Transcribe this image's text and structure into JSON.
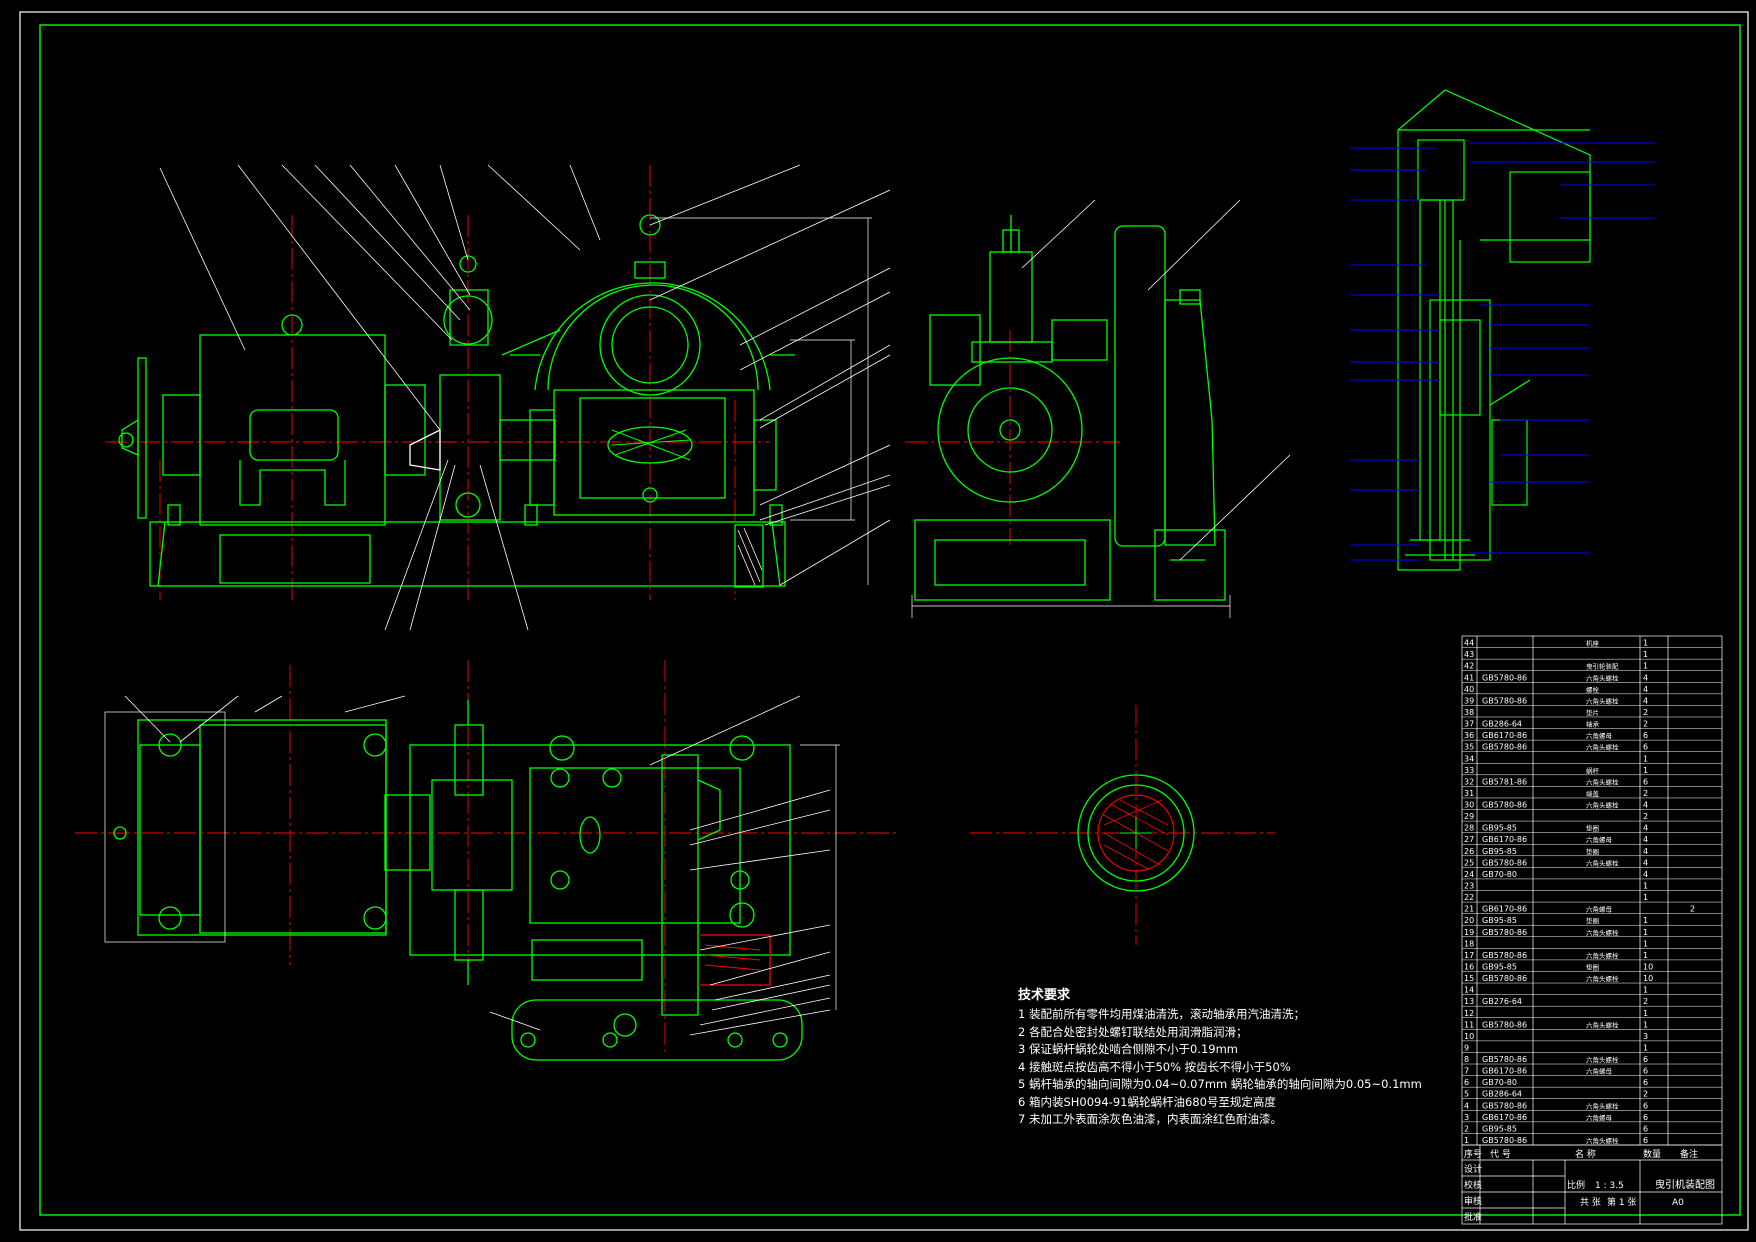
{
  "technical_requirements": {
    "title": "技术要求",
    "items": [
      "1 装配前所有零件均用煤油清洗，滚动轴承用汽油清洗；",
      "2 各配合处密封处螺钉联结处用润滑脂润滑；",
      "3 保证蜗杆蜗轮处啮合侧隙不小于0.19mm",
      "4 接触斑点按齿高不得小于50%  按齿长不得小于50%",
      "5 蜗杆轴承的轴向间隙为0.04~0.07mm 蜗轮轴承的轴向间隙为0.05~0.1mm",
      "6 箱内装SH0094-91蜗轮蜗杆油680号至规定高度",
      "7 未加工外表面涂灰色油漆，内表面涂红色耐油漆。"
    ]
  },
  "parts_list": {
    "headers": [
      "序号",
      "代 号",
      "名 称",
      "数量",
      "备注"
    ],
    "rows": [
      {
        "no": "44",
        "code": "",
        "name": "机座",
        "qty": "1"
      },
      {
        "no": "43",
        "code": "",
        "name": "",
        "qty": "1"
      },
      {
        "no": "42",
        "code": "",
        "name": "曳引轮装配",
        "qty": "1"
      },
      {
        "no": "41",
        "code": "GB5780-86",
        "name": "六角头螺栓",
        "qty": "4"
      },
      {
        "no": "40",
        "code": "",
        "name": "螺栓",
        "qty": "4"
      },
      {
        "no": "39",
        "code": "GB5780-86",
        "name": "六角头螺栓",
        "qty": "4"
      },
      {
        "no": "38",
        "code": "",
        "name": "垫片",
        "qty": "2"
      },
      {
        "no": "37",
        "code": "GB286-64",
        "name": "轴承",
        "qty": "2"
      },
      {
        "no": "36",
        "code": "GB6170-86",
        "name": "六角螺母",
        "qty": "6"
      },
      {
        "no": "35",
        "code": "GB5780-86",
        "name": "六角头螺栓",
        "qty": "6"
      },
      {
        "no": "34",
        "code": "",
        "name": "",
        "qty": "1"
      },
      {
        "no": "33",
        "code": "",
        "name": "蜗杆",
        "qty": "1"
      },
      {
        "no": "32",
        "code": "GB5781-86",
        "name": "六角头螺栓",
        "qty": "6"
      },
      {
        "no": "31",
        "code": "",
        "name": "端盖",
        "qty": "2"
      },
      {
        "no": "30",
        "code": "GB5780-86",
        "name": "六角头螺栓",
        "qty": "4"
      },
      {
        "no": "29",
        "code": "",
        "name": "",
        "qty": "2"
      },
      {
        "no": "28",
        "code": "GB95-85",
        "name": "垫圈",
        "qty": "4"
      },
      {
        "no": "27",
        "code": "GB6170-86",
        "name": "六角螺母",
        "qty": "4"
      },
      {
        "no": "26",
        "code": "GB95-85",
        "name": "垫圈",
        "qty": "4"
      },
      {
        "no": "25",
        "code": "GB5780-86",
        "name": "六角头螺栓",
        "qty": "4"
      },
      {
        "no": "24",
        "code": "GB70-80",
        "name": "",
        "qty": "4"
      },
      {
        "no": "23",
        "code": "",
        "name": "",
        "qty": "1"
      },
      {
        "no": "22",
        "code": "",
        "name": "",
        "qty": "1"
      },
      {
        "no": "21",
        "code": "GB6170-86",
        "name": "六角螺母",
        "qty": "",
        "note": "2"
      },
      {
        "no": "20",
        "code": "GB95-85",
        "name": "垫圈",
        "qty": "1"
      },
      {
        "no": "19",
        "code": "GB5780-86",
        "name": "六角头螺栓",
        "qty": "1"
      },
      {
        "no": "18",
        "code": "",
        "name": "",
        "qty": "1"
      },
      {
        "no": "17",
        "code": "GB5780-86",
        "name": "六角头螺栓",
        "qty": "1"
      },
      {
        "no": "16",
        "code": "GB95-85",
        "name": "垫圈",
        "qty": "10"
      },
      {
        "no": "15",
        "code": "GB5780-86",
        "name": "六角头螺栓",
        "qty": "10"
      },
      {
        "no": "14",
        "code": "",
        "name": "",
        "qty": "1"
      },
      {
        "no": "13",
        "code": "GB276-64",
        "name": "",
        "qty": "2"
      },
      {
        "no": "12",
        "code": "",
        "name": "",
        "qty": "1"
      },
      {
        "no": "11",
        "code": "GB5780-86",
        "name": "六角头螺栓",
        "qty": "1"
      },
      {
        "no": "10",
        "code": "",
        "name": "",
        "qty": "3"
      },
      {
        "no": "9",
        "code": "",
        "name": "",
        "qty": "1"
      },
      {
        "no": "8",
        "code": "GB5780-86",
        "name": "六角头螺栓",
        "qty": "6"
      },
      {
        "no": "7",
        "code": "GB6170-86",
        "name": "六角螺母",
        "qty": "6"
      },
      {
        "no": "6",
        "code": "GB70-80",
        "name": "",
        "qty": "6"
      },
      {
        "no": "5",
        "code": "GB286-64",
        "name": "",
        "qty": "2"
      },
      {
        "no": "4",
        "code": "GB5780-86",
        "name": "六角头螺栓",
        "qty": "6"
      },
      {
        "no": "3",
        "code": "GB6170-86",
        "name": "六角螺母",
        "qty": "6"
      },
      {
        "no": "2",
        "code": "GB95-85",
        "name": "",
        "qty": "6"
      },
      {
        "no": "1",
        "code": "GB5780-86",
        "name": "六角头螺栓",
        "qty": "6"
      }
    ]
  },
  "title_block": {
    "scale_label": "比例",
    "scale_value": "1 : 3.5",
    "drawing_name": "曳引机装配图",
    "sheet_label": "共 张",
    "page_label": "第 1 张",
    "sheet_size": "A0",
    "roles": [
      "设计",
      "校核",
      "审核",
      "批准"
    ]
  },
  "colors": {
    "background": "#000000",
    "frame": "#ffffff",
    "geometry": "#00ff00",
    "centerline": "#ff0000",
    "leader": "#ffffff",
    "isometric_callout": "#0000ff"
  }
}
